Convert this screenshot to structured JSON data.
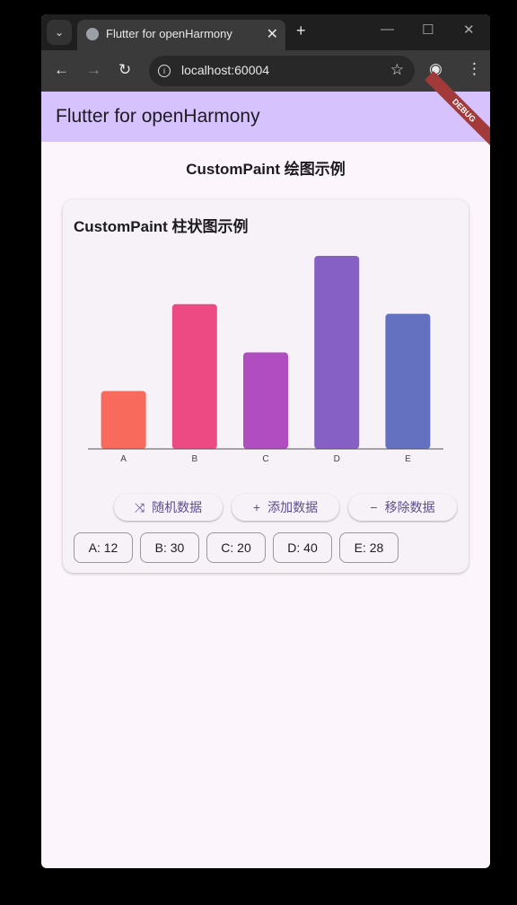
{
  "browser": {
    "tab_title": "Flutter for openHarmony",
    "url": "localhost:60004"
  },
  "app": {
    "title": "Flutter for openHarmony",
    "debug_banner": "DEBUG",
    "page_title": "CustomPaint 绘图示例",
    "card_title": "CustomPaint 柱状图示例"
  },
  "buttons": {
    "random": "随机数据",
    "add": "添加数据",
    "remove": "移除数据"
  },
  "chips": [
    "A: 12",
    "B: 30",
    "C: 20",
    "D: 40",
    "E: 28"
  ],
  "chart_data": {
    "type": "bar",
    "categories": [
      "A",
      "B",
      "C",
      "D",
      "E"
    ],
    "values": [
      12,
      30,
      20,
      40,
      28
    ],
    "colors": [
      "#f76a5c",
      "#ec4a82",
      "#b04dc0",
      "#8760c6",
      "#6471c1"
    ],
    "ylim": [
      0,
      40
    ],
    "grid": false
  }
}
